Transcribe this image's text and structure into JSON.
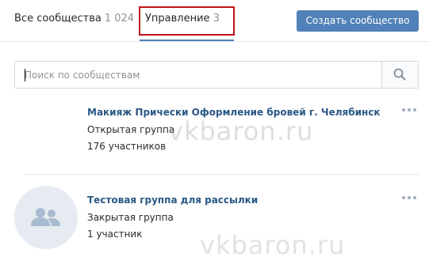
{
  "tabs": [
    {
      "label": "Все сообщества",
      "count": "1 024"
    },
    {
      "label": "Управление",
      "count": "3"
    }
  ],
  "create_button": "Создать сообщество",
  "search": {
    "placeholder": "Поиск по сообществам",
    "value": ""
  },
  "groups": [
    {
      "title": "Макияж Прически Оформление бровей г. Челябинск",
      "type": "Открытая группа",
      "members": "176 участников"
    },
    {
      "title": "Тестовая группа для рассылки",
      "type": "Закрытая группа",
      "members": "1 участник"
    }
  ],
  "watermark": "vkbaron.ru",
  "colors": {
    "accent": "#5181b8",
    "link": "#2a5885",
    "highlight": "#c0141a"
  }
}
